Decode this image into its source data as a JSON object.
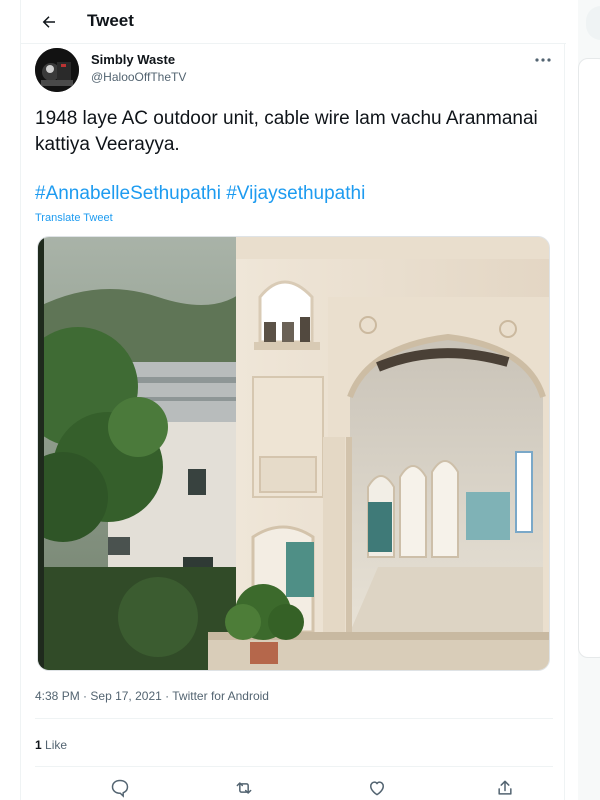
{
  "header": {
    "title": "Tweet",
    "back_icon": "arrow-left-icon"
  },
  "author": {
    "display_name": "Simbly Waste",
    "handle": "@HalooOffTheTV",
    "avatar_icon": "avatar-image"
  },
  "tweet": {
    "text": "1948 laye AC outdoor unit, cable wire lam vachu Aranmanai kattiya Veerayya.",
    "hashtags": [
      "#AnnabelleSethupathi",
      "#Vijaysethupathi"
    ],
    "translate_label": "Translate Tweet",
    "media_description": "photo"
  },
  "meta": {
    "time": "4:38 PM",
    "separator": "·",
    "date": "Sep 17, 2021",
    "source": "Twitter for Android"
  },
  "engagement": {
    "like_count": "1",
    "like_label": "Like"
  },
  "actions": [
    "reply-icon",
    "retweet-icon",
    "like-icon",
    "share-icon"
  ],
  "colors": {
    "accent": "#1d9bf0",
    "text": "#0f1419",
    "secondary": "#536471",
    "border": "#eff3f4"
  }
}
